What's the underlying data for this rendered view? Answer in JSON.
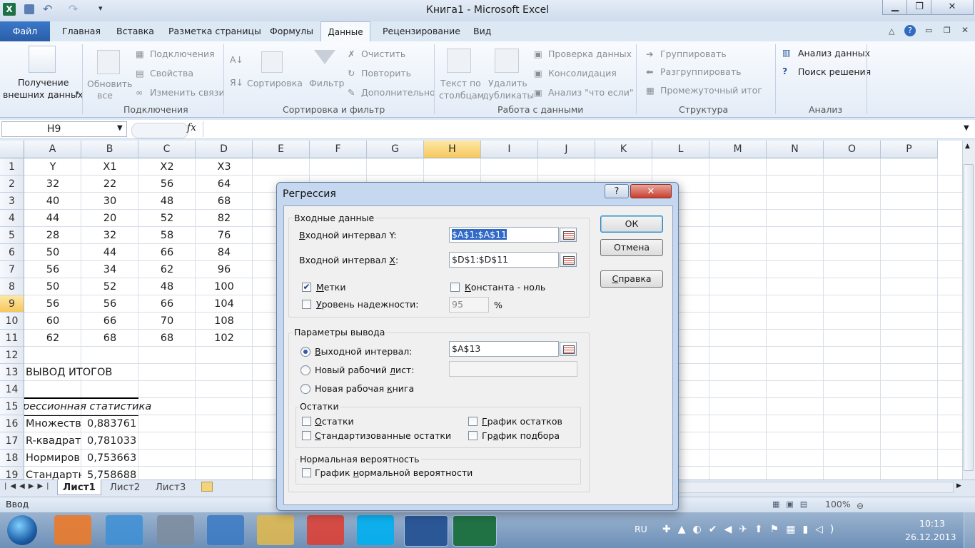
{
  "window": {
    "title": "Книга1 - Microsoft Excel"
  },
  "ribbon": {
    "tabs": [
      "Файл",
      "Главная",
      "Вставка",
      "Разметка страницы",
      "Формулы",
      "Данные",
      "Рецензирование",
      "Вид"
    ],
    "get_external": [
      "Получение",
      "внешних данных"
    ],
    "refresh": [
      "Обновить",
      "все"
    ],
    "connections_items": [
      "Подключения",
      "Свойства",
      "Изменить связи"
    ],
    "sort_label": "Сортировка",
    "filter_label": "Фильтр",
    "filter_items": [
      "Очистить",
      "Повторить",
      "Дополнительно"
    ],
    "text_to_cols": [
      "Текст по",
      "столбцам"
    ],
    "remove_dup": [
      "Удалить",
      "дубликаты"
    ],
    "datatools_items": [
      "Проверка данных",
      "Консолидация",
      "Анализ \"что если\""
    ],
    "outline_items": [
      "Группировать",
      "Разгруппировать",
      "Промежуточный итог"
    ],
    "analysis_items": [
      "Анализ данных",
      "Поиск решения"
    ],
    "groups": [
      "Подключения",
      "Сортировка и фильтр",
      "Работа с данными",
      "Структура",
      "Анализ"
    ]
  },
  "formula_bar": {
    "name_box": "H9",
    "fx": "fx",
    "formula": ""
  },
  "grid": {
    "columns": [
      "A",
      "B",
      "C",
      "D",
      "E",
      "F",
      "G",
      "H",
      "I",
      "J",
      "K",
      "L",
      "M",
      "N",
      "O",
      "P"
    ],
    "selected_col": "H",
    "selected_row": "9",
    "row_numbers": [
      "1",
      "2",
      "3",
      "4",
      "5",
      "6",
      "7",
      "8",
      "9",
      "10",
      "11",
      "12",
      "13",
      "14",
      "15",
      "16",
      "17",
      "18",
      "19"
    ],
    "rows": [
      [
        "Y",
        "X1",
        "X2",
        "X3"
      ],
      [
        "32",
        "22",
        "56",
        "64"
      ],
      [
        "40",
        "30",
        "48",
        "68"
      ],
      [
        "44",
        "20",
        "52",
        "82"
      ],
      [
        "28",
        "32",
        "58",
        "76"
      ],
      [
        "50",
        "44",
        "66",
        "84"
      ],
      [
        "56",
        "34",
        "62",
        "96"
      ],
      [
        "50",
        "52",
        "48",
        "100"
      ],
      [
        "56",
        "56",
        "66",
        "104"
      ],
      [
        "60",
        "66",
        "70",
        "108"
      ],
      [
        "62",
        "68",
        "68",
        "102"
      ]
    ],
    "r13": "ВЫВОД ИТОГОВ",
    "r15": "рессионная статистика",
    "stats": [
      [
        "Множеств",
        "0,883761"
      ],
      [
        "R-квадрат",
        "0,781033"
      ],
      [
        "Нормиров",
        "0,753663"
      ],
      [
        "Стандартн",
        "5,758688"
      ]
    ]
  },
  "sheets": [
    "Лист1",
    "Лист2",
    "Лист3"
  ],
  "status": {
    "mode": "Ввод",
    "zoom": "100%"
  },
  "taskbar": {
    "lang": "RU",
    "time": "10:13",
    "date": "26.12.2013"
  },
  "dialog": {
    "title": "Регрессия",
    "input_group": "Входные данные",
    "input_y_label": "Входной интервал Y:",
    "input_y_value": "$A$1:$A$11",
    "input_x_label": "Входной интервал X:",
    "input_x_value": "$D$1:$D$11",
    "labels_chk": "Метки",
    "labels_checked": true,
    "const_zero": "Константа - ноль",
    "confidence": "Уровень надежности:",
    "confidence_value": "95",
    "percent": "%",
    "output_group": "Параметры вывода",
    "output_range": "Выходной интервал:",
    "output_range_value": "$A$13",
    "new_sheet": "Новый рабочий лист:",
    "new_book": "Новая рабочая книга",
    "residuals_group": "Остатки",
    "residuals": "Остатки",
    "residual_plots": "График остатков",
    "std_residuals": "Стандартизованные остатки",
    "line_fit": "График подбора",
    "normal_group": "Нормальная вероятность",
    "normal_plot": "График нормальной вероятности",
    "ok": "ОК",
    "cancel": "Отмена",
    "help": "Справка"
  }
}
